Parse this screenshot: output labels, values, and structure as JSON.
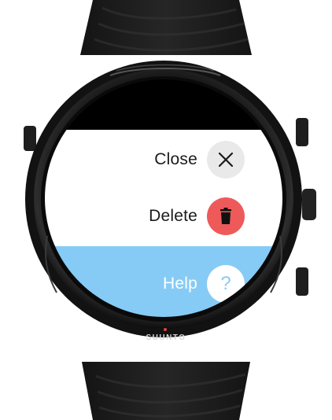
{
  "device": {
    "brand": "SUUNTO",
    "accent_color": "#e0453a"
  },
  "menu": {
    "items": [
      {
        "label": "Close",
        "icon": "close-icon",
        "button_color": "#e9e9e9"
      },
      {
        "label": "Delete",
        "icon": "trash-icon",
        "button_color": "#ee5a5a"
      },
      {
        "label": "Help",
        "icon": "question-mark-icon",
        "glyph": "?",
        "button_color": "#ffffff"
      }
    ]
  },
  "colors": {
    "help_background": "#86cbf5",
    "menu_background": "#ffffff",
    "screen_background": "#000000"
  }
}
